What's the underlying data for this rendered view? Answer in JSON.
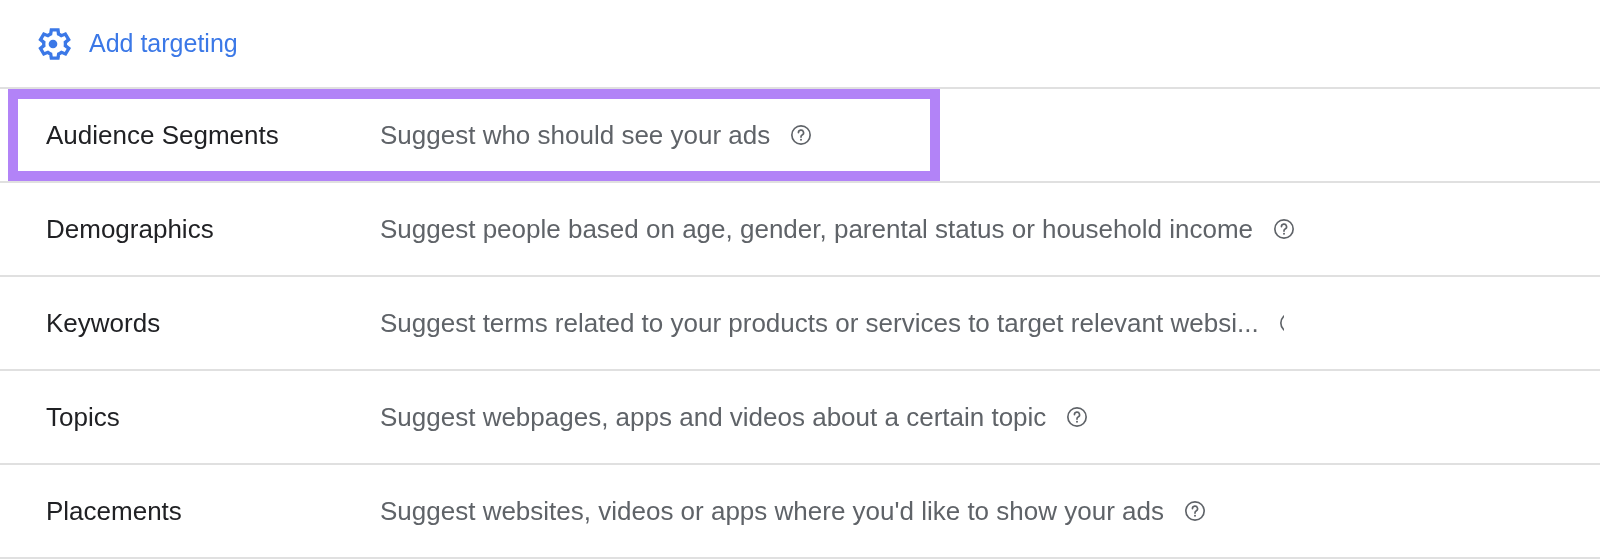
{
  "header": {
    "link": "Add targeting"
  },
  "rows": [
    {
      "label": "Audience Segments",
      "description": "Suggest who should see your ads",
      "highlighted": true,
      "help_clipped": false
    },
    {
      "label": "Demographics",
      "description": "Suggest people based on age, gender, parental status or household income",
      "highlighted": false,
      "help_clipped": false
    },
    {
      "label": "Keywords",
      "description": "Suggest terms related to your products or services to target relevant websi...",
      "highlighted": false,
      "help_clipped": true
    },
    {
      "label": "Topics",
      "description": "Suggest webpages, apps and videos about a certain topic",
      "highlighted": false,
      "help_clipped": false
    },
    {
      "label": "Placements",
      "description": "Suggest websites, videos or apps where you'd like to show your ads",
      "highlighted": false,
      "help_clipped": false
    }
  ]
}
